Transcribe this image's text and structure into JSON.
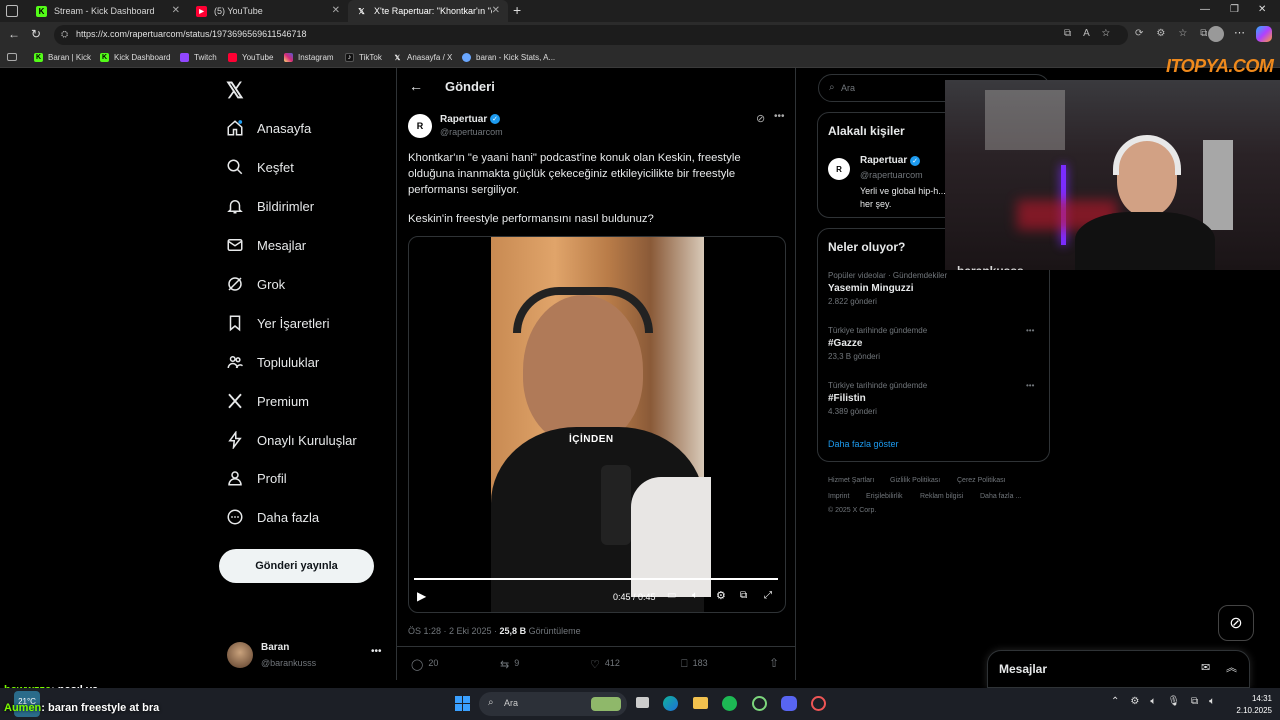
{
  "browser": {
    "tabs": [
      {
        "label": "Stream - Kick Dashboard",
        "icon": "kick-icon"
      },
      {
        "label": "(5) YouTube",
        "icon": "youtube-icon"
      },
      {
        "label": "X'te Rapertuar: \"Khontkar'ın \"e ya",
        "icon": "x-icon"
      }
    ],
    "url": "https://x.com/rapertuarcom/status/1973696569611546718",
    "bookmarks": [
      "Baran | Kick",
      "Kick Dashboard",
      "Twitch",
      "YouTube",
      "Instagram",
      "TikTok",
      "Anasayfa / X",
      "baran - Kick Stats, A..."
    ]
  },
  "nav": {
    "items": [
      "Anasayfa",
      "Keşfet",
      "Bildirimler",
      "Mesajlar",
      "Grok",
      "Yer İşaretleri",
      "Topluluklar",
      "Premium",
      "Onaylı Kuruluşlar",
      "Profil",
      "Daha fazla"
    ],
    "post_button": "Gönderi yayınla",
    "user_name": "Baran",
    "user_handle": "@barankusss"
  },
  "post": {
    "header": "Gönderi",
    "author": "Rapertuar",
    "handle": "@rapertuarcom",
    "text1": "Khontkar'ın \"e yaani hani\" podcast'ine konuk olan Keskin, freestyle olduğuna inanmakta güçlük çekeceğiniz etkileyicilikte bir freestyle performansı sergiliyor.",
    "text2": "Keskin'in freestyle performansını nasıl buldunuz?",
    "video_caption": "İÇİNDEN",
    "video_time": "0:45 / 0:45",
    "meta_time": "ÖS 1:28 · 2 Eki 2025 · ",
    "views": "25,8 B",
    "views_label": "Görüntüleme",
    "replies": "20",
    "reposts": "9",
    "likes": "412",
    "bookmarks": "183"
  },
  "right": {
    "search_placeholder": "Ara",
    "related_title": "Alakalı kişiler",
    "related_name": "Rapertuar",
    "related_handle": "@rapertuarcom",
    "related_bio": "Yerli ve global hip-h... her şey.",
    "trends_title": "Neler oluyor?",
    "trends": [
      {
        "label": "Popüler videolar · Gündemdekiler",
        "name": "Yasemin Minguzzi",
        "count": "2.822 gönderi"
      },
      {
        "label": "Türkiye tarihinde gündemde",
        "name": "#Gazze",
        "count": "23,3 B gönderi"
      },
      {
        "label": "Türkiye tarihinde gündemde",
        "name": "#Filistin",
        "count": "4.389 gönderi"
      }
    ],
    "show_more": "Daha fazla göster",
    "footer": [
      "Hizmet Şartları",
      "Gizlilik Politikası",
      "Çerez Politikası",
      "Imprint",
      "Erişilebilirlik",
      "Reklam bilgisi",
      "Daha fazla ...",
      "© 2025 X Corp."
    ],
    "messages": "Mesajlar"
  },
  "overlay": {
    "brand": "ITOPYA.COM",
    "streamer": "barankusss",
    "chat": [
      {
        "user": "hawwzza",
        "text": ": nasıl ya"
      },
      {
        "user": "Aumen",
        "text": ": baran freestyle at bra"
      }
    ]
  },
  "taskbar": {
    "search": "Ara",
    "weather": "21°C",
    "time": "14:31",
    "date": "2.10.2025"
  }
}
